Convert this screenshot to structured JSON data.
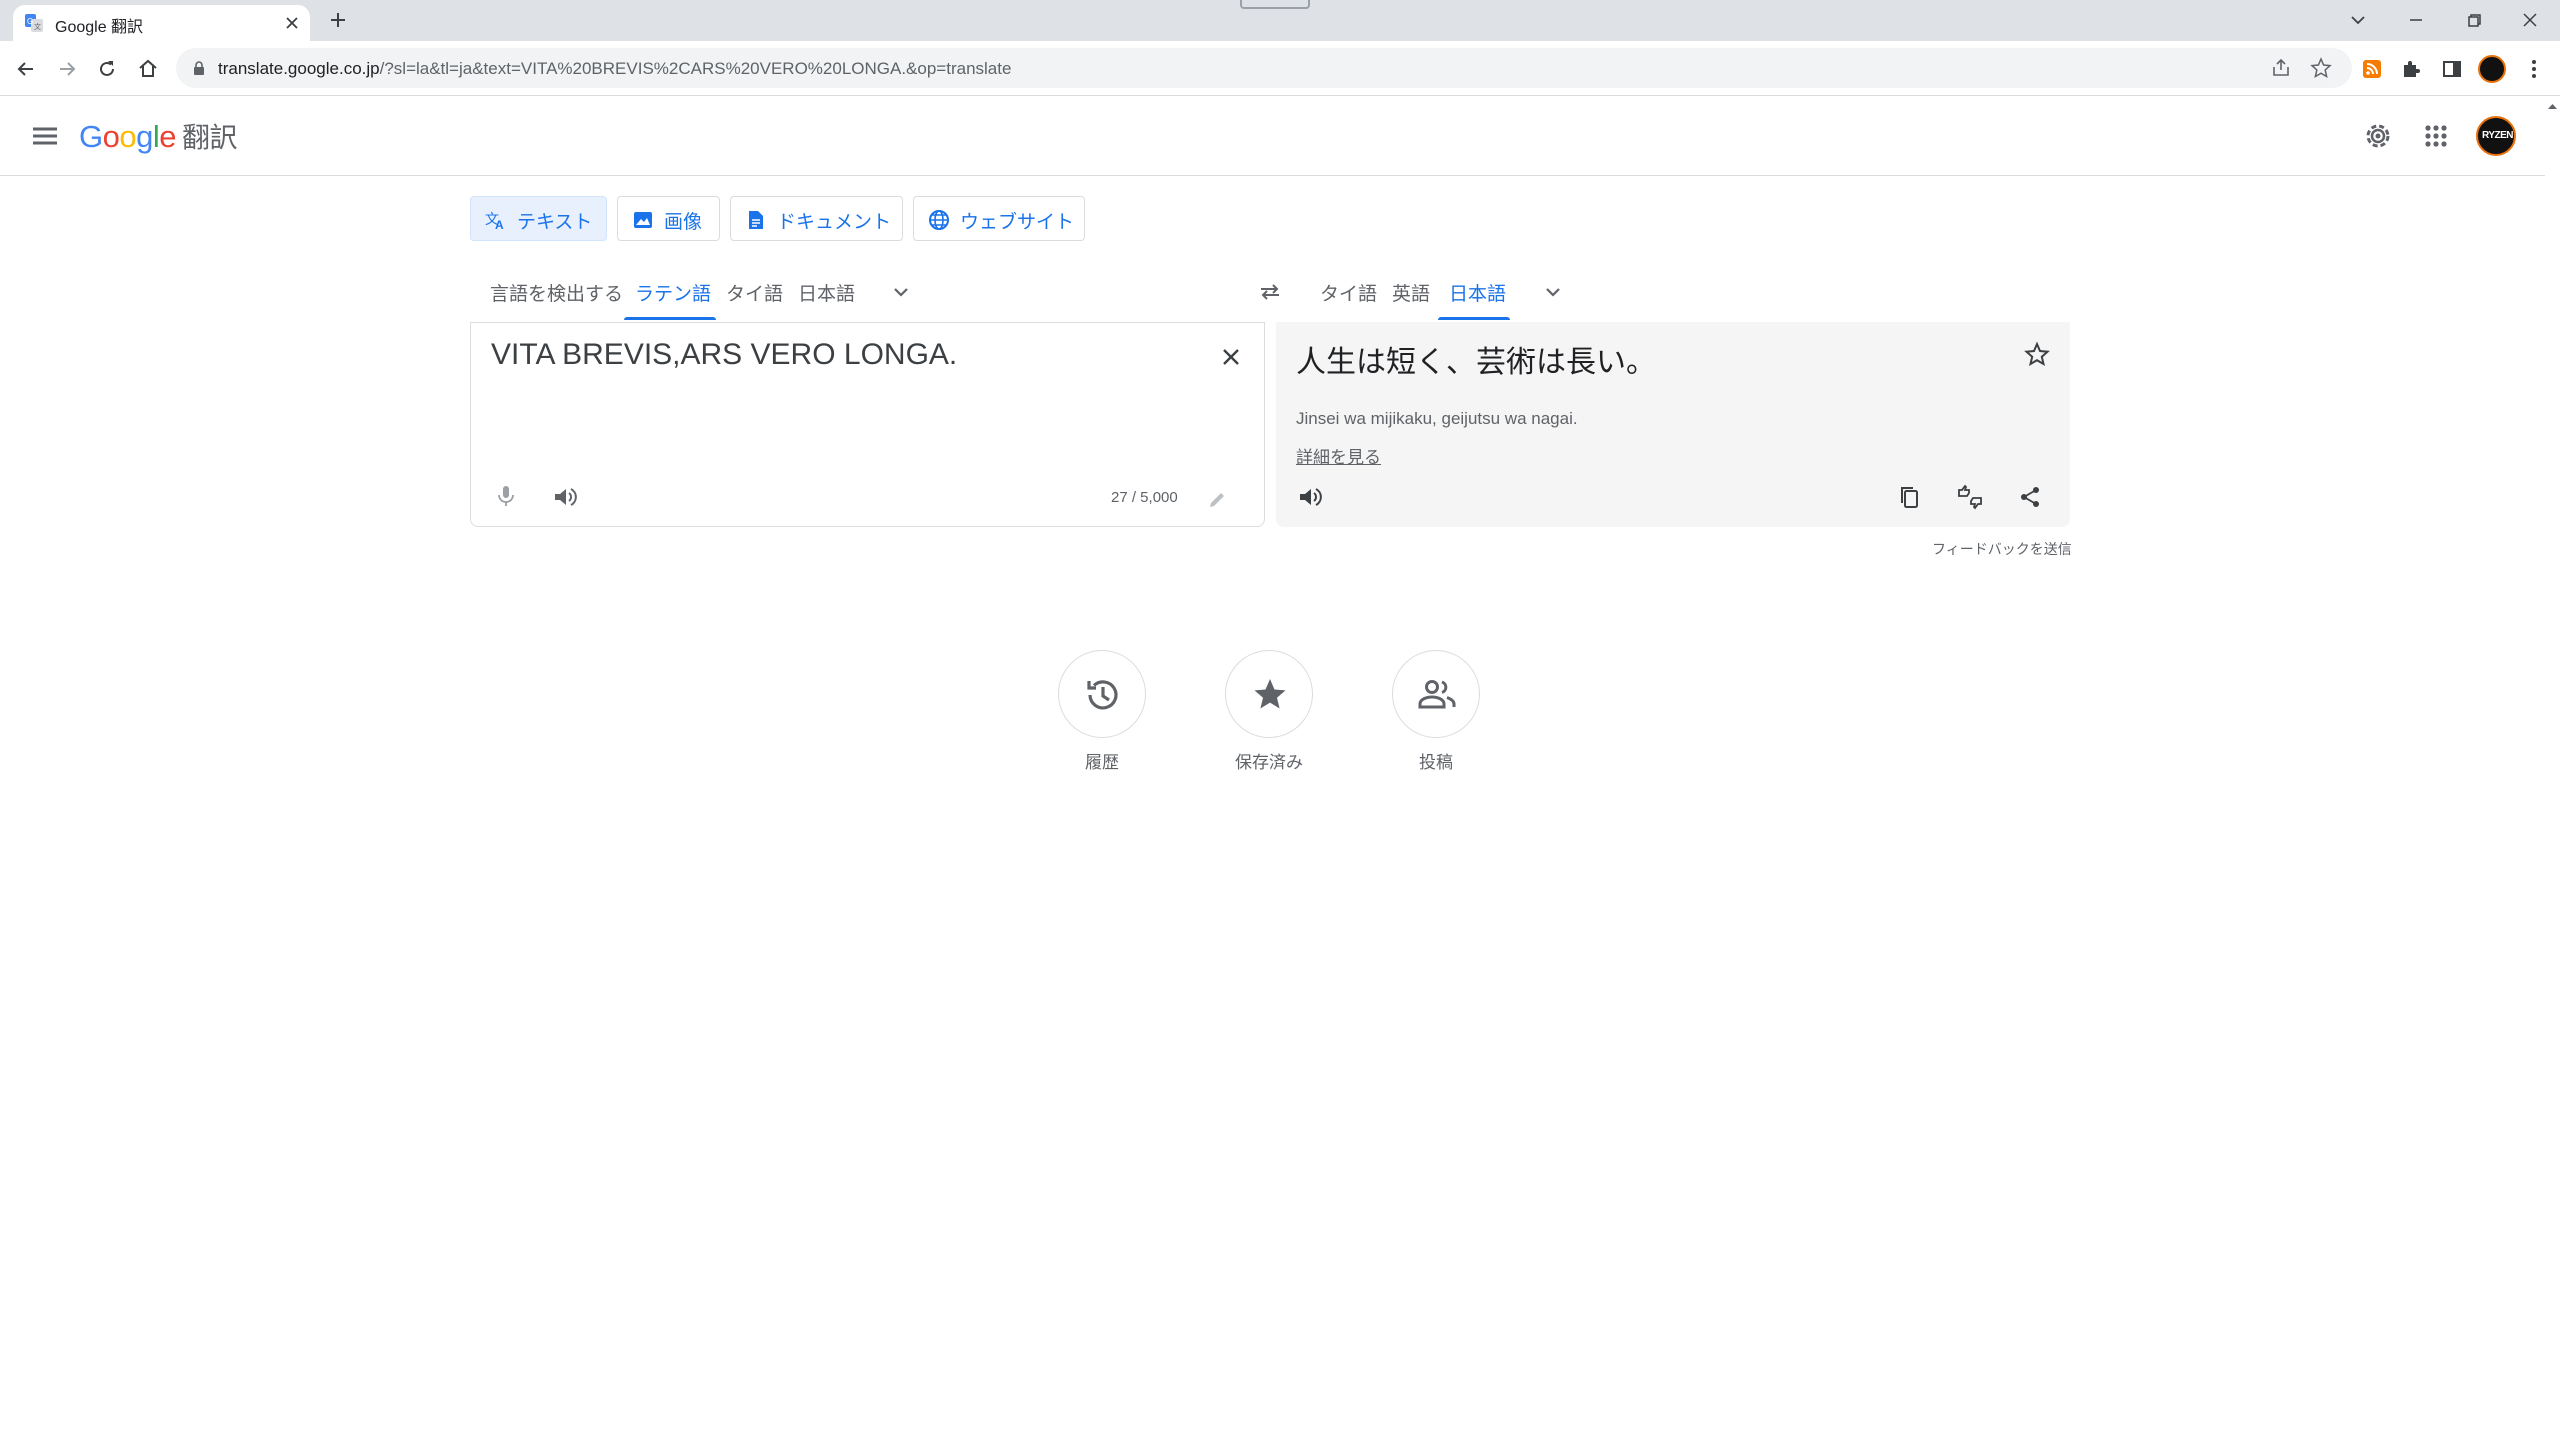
{
  "browser": {
    "tab_title": "Google 翻訳",
    "url_host": "translate.google.co.jp",
    "url_rest": "/?sl=la&tl=ja&text=VITA%20BREVIS%2CARS%20VERO%20LONGA.&op=translate"
  },
  "header": {
    "logo_g1": "G",
    "logo_o1": "o",
    "logo_o2": "o",
    "logo_g2": "g",
    "logo_l": "l",
    "logo_e": "e",
    "product": "翻訳",
    "avatar_text": "RYZEN"
  },
  "modes": [
    "テキスト",
    "画像",
    "ドキュメント",
    "ウェブサイト"
  ],
  "source_langs": [
    "言語を検出する",
    "ラテン語",
    "タイ語",
    "日本語"
  ],
  "target_langs": [
    "タイ語",
    "英語",
    "日本語"
  ],
  "source": {
    "text": "VITA BREVIS,ARS VERO LONGA.",
    "count": "27 / 5,000"
  },
  "target": {
    "text": "人生は短く、芸術は長い。",
    "romanization": "Jinsei wa mijikaku, geijutsu wa nagai.",
    "more_link": "詳細を見る",
    "feedback": "フィードバックを送信"
  },
  "bottom": [
    "履歴",
    "保存済み",
    "投稿"
  ],
  "colors": {
    "accent": "#1a73e8",
    "active_mode_bg": "#e8f0fe",
    "target_bg": "#f5f5f5"
  }
}
